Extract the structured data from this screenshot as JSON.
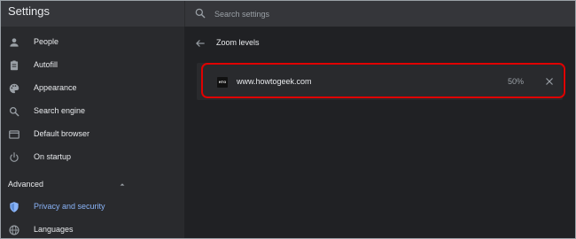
{
  "app": {
    "title": "Settings"
  },
  "search": {
    "placeholder": "Search settings"
  },
  "sidebar": {
    "items": [
      {
        "label": "People",
        "icon": "person-icon"
      },
      {
        "label": "Autofill",
        "icon": "clipboard-icon"
      },
      {
        "label": "Appearance",
        "icon": "palette-icon"
      },
      {
        "label": "Search engine",
        "icon": "search-icon"
      },
      {
        "label": "Default browser",
        "icon": "browser-icon"
      },
      {
        "label": "On startup",
        "icon": "power-icon"
      }
    ],
    "advanced_label": "Advanced",
    "advanced_items": [
      {
        "label": "Privacy and security",
        "icon": "shield-icon",
        "active": true
      },
      {
        "label": "Languages",
        "icon": "globe-icon"
      }
    ]
  },
  "main": {
    "title": "Zoom levels",
    "entries": [
      {
        "favicon_text": "HTG",
        "site": "www.howtogeek.com",
        "zoom": "50%"
      }
    ]
  },
  "colors": {
    "background": "#202124",
    "sidebar": "#292a2d",
    "accent": "#8ab4f8",
    "highlight": "#e00000"
  }
}
